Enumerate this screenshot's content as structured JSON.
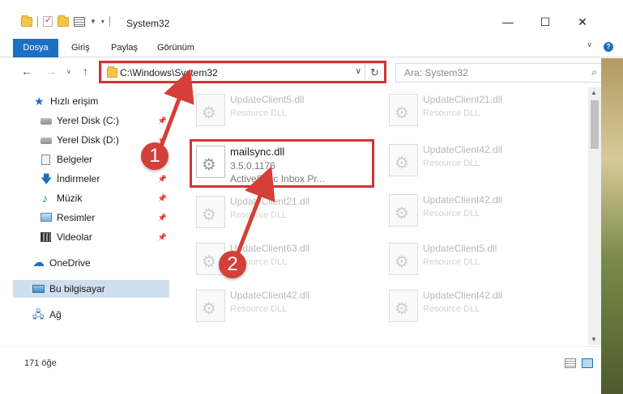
{
  "window": {
    "title": "System32",
    "controls": {
      "minimize": "—",
      "maximize": "☐",
      "close": "✕"
    }
  },
  "ribbon": {
    "tabs": [
      "Dosya",
      "Giriş",
      "Paylaş",
      "Görünüm"
    ]
  },
  "address": {
    "path": "C:\\Windows\\System32",
    "search_placeholder": "Ara: System32"
  },
  "sidebar": {
    "items": [
      {
        "label": "Hızlı erişim",
        "icon": "star-icon"
      },
      {
        "label": "Yerel Disk (C:)",
        "icon": "drive-icon",
        "pinned": true
      },
      {
        "label": "Yerel Disk (D:)",
        "icon": "drive-icon",
        "pinned": true
      },
      {
        "label": "Belgeler",
        "icon": "document-icon",
        "pinned": true
      },
      {
        "label": "İndirmeler",
        "icon": "download-icon",
        "pinned": true
      },
      {
        "label": "Müzik",
        "icon": "music-icon",
        "pinned": true
      },
      {
        "label": "Resimler",
        "icon": "pictures-icon",
        "pinned": true
      },
      {
        "label": "Videolar",
        "icon": "videos-icon",
        "pinned": true
      },
      {
        "label": "OneDrive",
        "icon": "cloud-icon"
      },
      {
        "label": "Bu bilgisayar",
        "icon": "computer-icon",
        "selected": true
      },
      {
        "label": "Ağ",
        "icon": "network-icon"
      }
    ]
  },
  "files": {
    "left": [
      {
        "name": "UpdateClient5.dll",
        "desc": "Resource DLL"
      },
      {
        "name": "mailsync.dll",
        "version": "3.5.0.1176",
        "desc": "ActiveSync Inbox Pr...",
        "focused": true
      },
      {
        "name": "UpdateClient21.dll",
        "desc": "Resource DLL"
      },
      {
        "name": "UpdateClient63.dll",
        "desc": "Resource DLL"
      },
      {
        "name": "UpdateClient42.dll",
        "desc": "Resource DLL"
      }
    ],
    "right": [
      {
        "name": "UpdateClient21.dll",
        "desc": "Resource DLL"
      },
      {
        "name": "UpdateClient42.dll",
        "desc": "Resource DLL"
      },
      {
        "name": "UpdateClient42.dll",
        "desc": "Resource DLL"
      },
      {
        "name": "UpdateClient5.dll",
        "desc": "Resource DLL"
      },
      {
        "name": "UpdateClient42.dll",
        "desc": "Resource DLL"
      }
    ]
  },
  "status": {
    "count": "171 öğe"
  },
  "callouts": [
    "1",
    "2"
  ],
  "colors": {
    "accent": "#1c6fc1",
    "highlight": "#d03434",
    "selection": "#d0dff0"
  }
}
